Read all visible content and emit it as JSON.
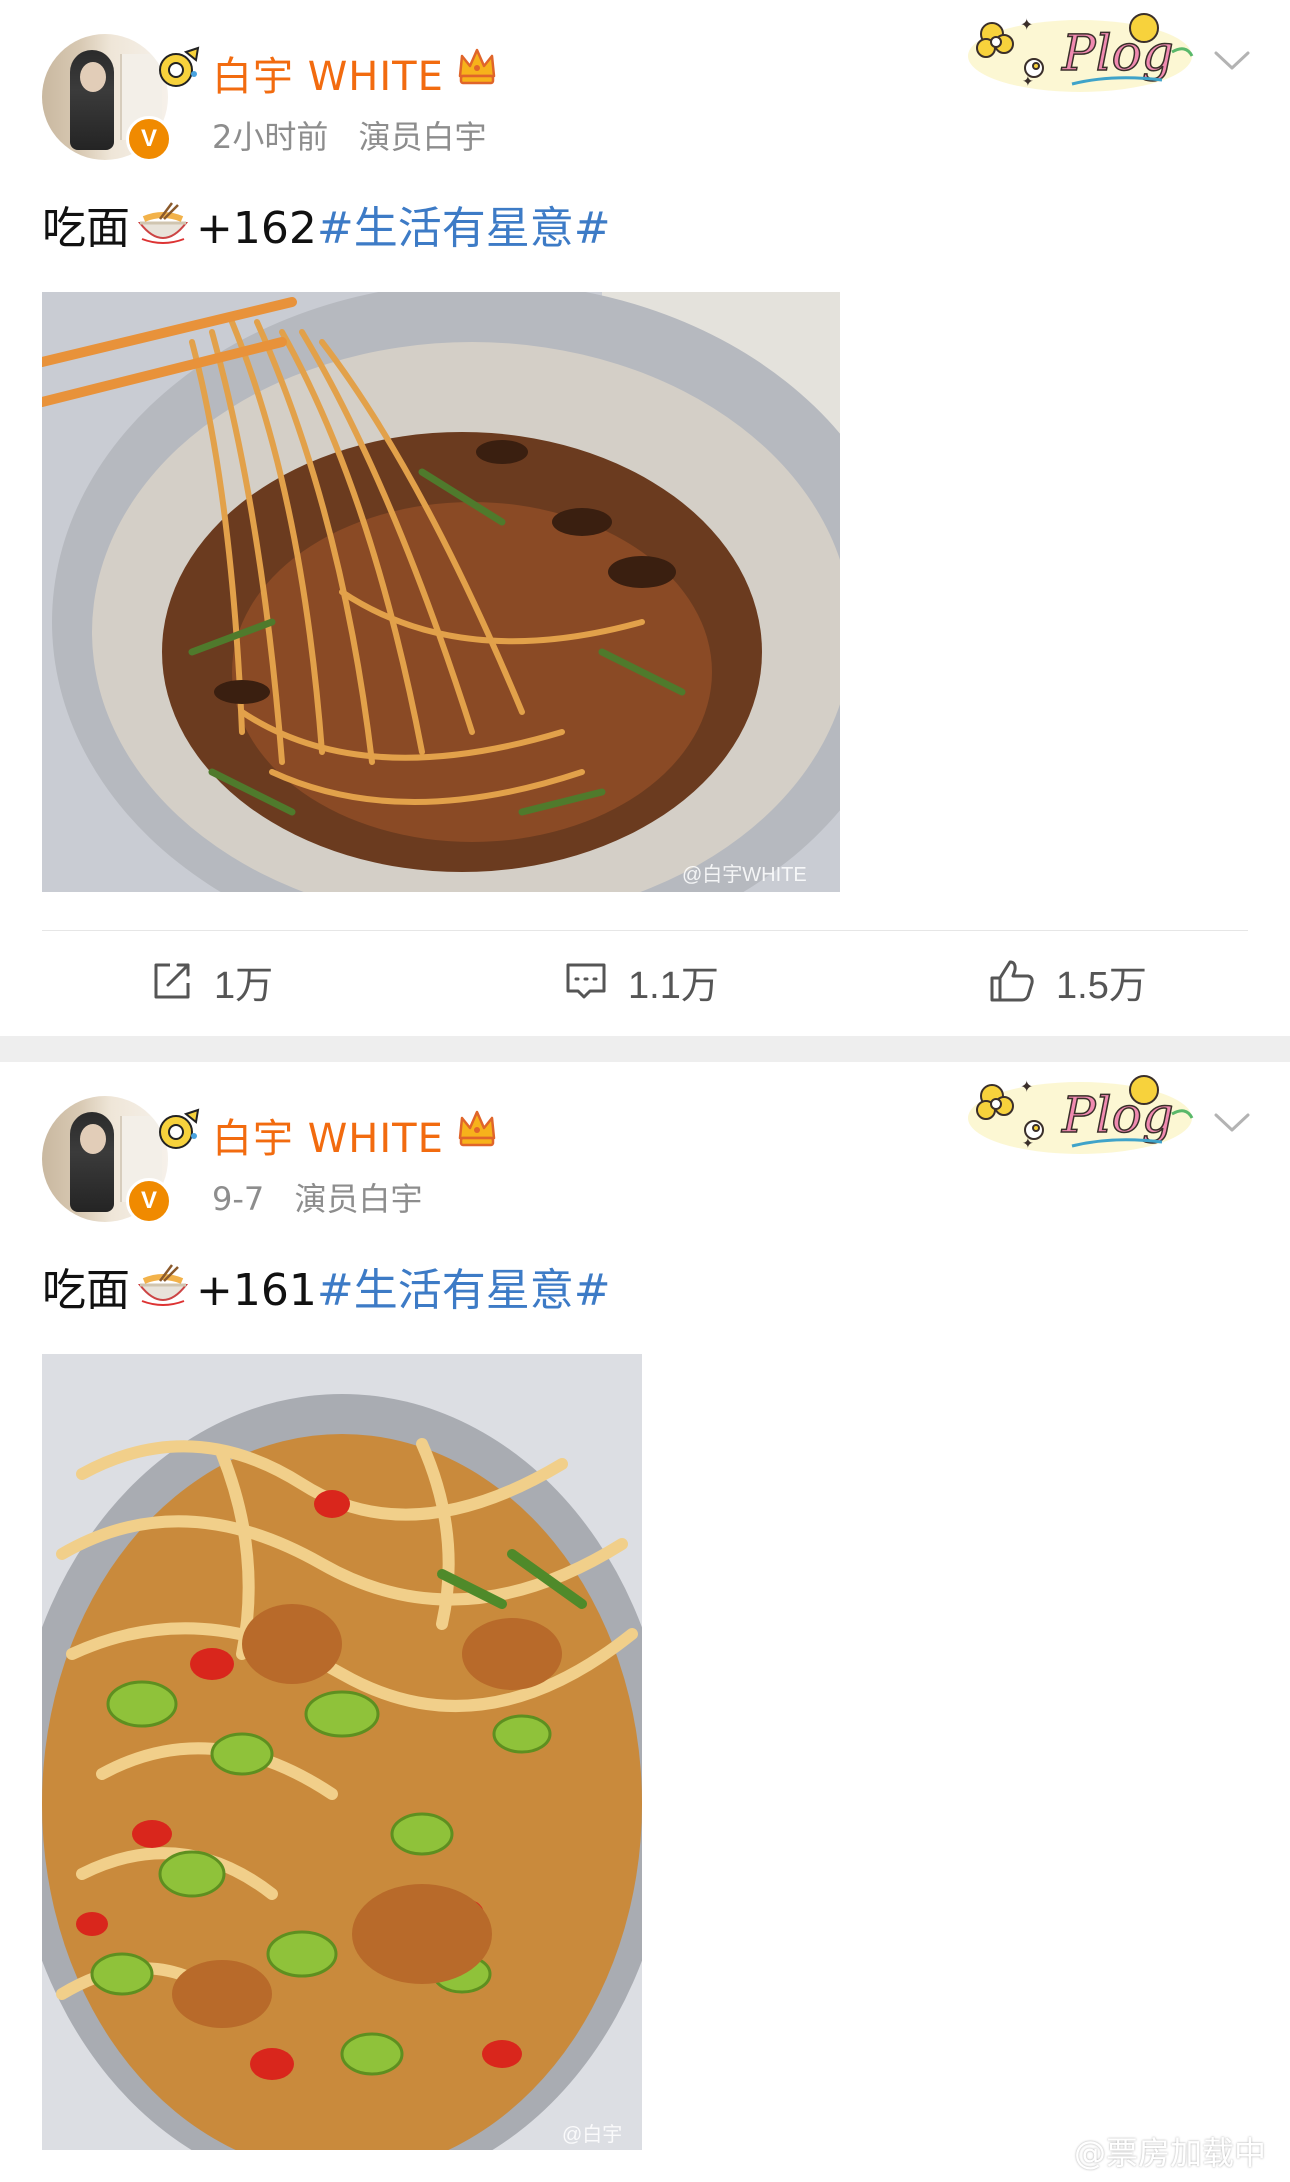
{
  "colors": {
    "username": "#f26b0f",
    "topic": "#3d7bc6",
    "meta": "#8d8d8d",
    "verified_badge": "#f08a00",
    "separator": "#eeeeee"
  },
  "posts": [
    {
      "author": "白宇 WHITE",
      "time": "2小时前",
      "source": "演员白宇",
      "badge": "V",
      "pendant": "Plog",
      "text_prefix": "吃面",
      "text_count": "+162",
      "topic": "#生活有星意#",
      "photo_watermark": "@白宇WHITE",
      "actions": {
        "share": "1万",
        "comments": "1.1万",
        "likes": "1.5万"
      }
    },
    {
      "author": "白宇 WHITE",
      "time": "9-7",
      "source": "演员白宇",
      "badge": "V",
      "pendant": "Plog",
      "text_prefix": "吃面",
      "text_count": "+161",
      "topic": "#生活有星意#",
      "photo_watermark": "@白宇"
    }
  ],
  "site_watermark": "@票房加载中",
  "icons": [
    "verified-v-icon",
    "crown-icon",
    "chevron-down-icon",
    "share-icon",
    "comment-icon",
    "like-icon",
    "noodle-bowl-emoji",
    "weibo-logo-icon"
  ]
}
